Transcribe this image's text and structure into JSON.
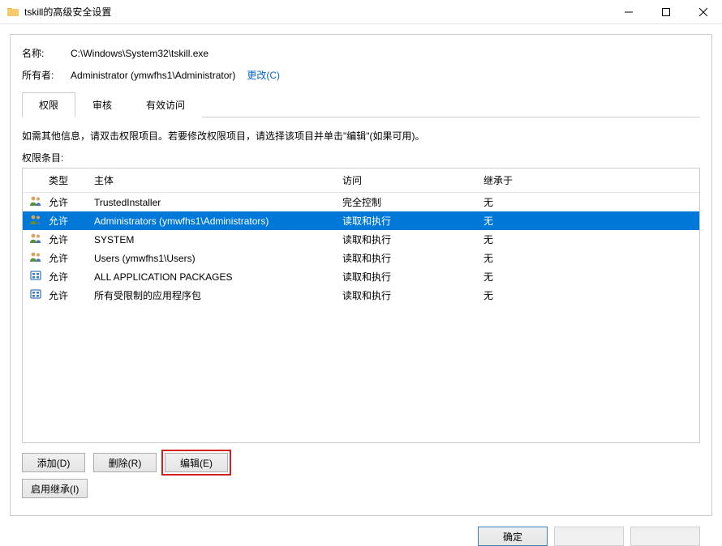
{
  "window": {
    "title": "tskill的高级安全设置"
  },
  "fields": {
    "name_label": "名称:",
    "name_value": "C:\\Windows\\System32\\tskill.exe",
    "owner_label": "所有者:",
    "owner_value": "Administrator (ymwfhs1\\Administrator)",
    "change_link": "更改(C)"
  },
  "tabs": {
    "permissions": "权限",
    "audit": "审核",
    "effective": "有效访问"
  },
  "help_text": "如需其他信息，请双击权限项目。若要修改权限项目，请选择该项目并单击\"编辑\"(如果可用)。",
  "entries_label": "权限条目:",
  "columns": {
    "type": "类型",
    "principal": "主体",
    "access": "访问",
    "inherited": "继承于"
  },
  "rows": [
    {
      "icon": "users",
      "type": "允许",
      "principal": "TrustedInstaller",
      "access": "完全控制",
      "inherited": "无",
      "selected": false
    },
    {
      "icon": "users",
      "type": "允许",
      "principal": "Administrators (ymwfhs1\\Administrators)",
      "access": "读取和执行",
      "inherited": "无",
      "selected": true
    },
    {
      "icon": "users",
      "type": "允许",
      "principal": "SYSTEM",
      "access": "读取和执行",
      "inherited": "无",
      "selected": false
    },
    {
      "icon": "users",
      "type": "允许",
      "principal": "Users (ymwfhs1\\Users)",
      "access": "读取和执行",
      "inherited": "无",
      "selected": false
    },
    {
      "icon": "pkg",
      "type": "允许",
      "principal": "ALL APPLICATION PACKAGES",
      "access": "读取和执行",
      "inherited": "无",
      "selected": false
    },
    {
      "icon": "pkg",
      "type": "允许",
      "principal": "所有受限制的应用程序包",
      "access": "读取和执行",
      "inherited": "无",
      "selected": false
    }
  ],
  "buttons": {
    "add": "添加(D)",
    "remove": "删除(R)",
    "edit": "编辑(E)",
    "enable_inherit": "启用继承(I)",
    "ok": "确定",
    "cancel": "",
    "apply": ""
  }
}
